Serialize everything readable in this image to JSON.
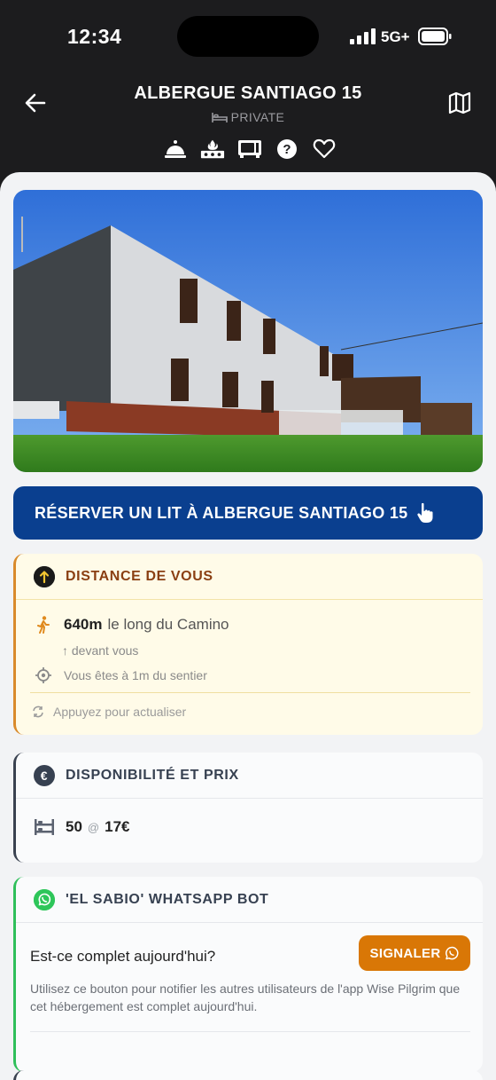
{
  "status": {
    "time": "12:34",
    "network": "5G+"
  },
  "header": {
    "title": "ALBERGUE SANTIAGO 15",
    "subtitle": "PRIVATE",
    "amenities": [
      "reception-bell-icon",
      "kitchen-stove-icon",
      "microwave-icon",
      "help-icon",
      "favorite-heart-icon"
    ]
  },
  "reserve_label": "RÉSERVER UN LIT À ALBERGUE SANTIAGO 15",
  "distance": {
    "title": "DISTANCE DE VOUS",
    "value": "640m",
    "along": "le long du Camino",
    "direction": "↑ devant vous",
    "trail_note": "Vous êtes à 1m du sentier",
    "refresh": "Appuyez pour actualiser"
  },
  "availability": {
    "title": "DISPONIBILITÉ ET PRIX",
    "beds": "50",
    "at": "@",
    "price": "17€",
    "icon_text": "€"
  },
  "bot": {
    "title": "'EL SABIO' WHATSAPP BOT",
    "question": "Est-ce complet aujourd'hui?",
    "button_label": "SIGNALER",
    "description": "Utilisez ce bouton pour notifier les autres utilisateurs de l'app Wise Pilgrim que cet hébergement est complet aujourd'hui."
  },
  "colors": {
    "header_bg": "#1c1c1e",
    "reserve_bg": "#0a3f8f",
    "distance_accent": "#d98a2b",
    "report_bg": "#d97706",
    "whatsapp_green": "#2ec65a"
  }
}
